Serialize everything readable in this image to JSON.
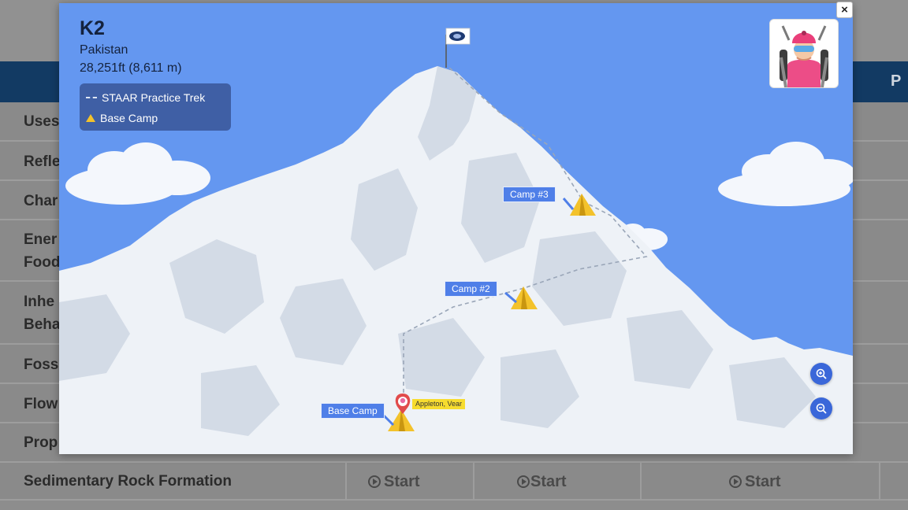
{
  "background": {
    "header_right": "P",
    "rows": [
      {
        "label": "Uses"
      },
      {
        "label": "Refle"
      },
      {
        "label": "Char"
      },
      {
        "label": "Ener Food"
      },
      {
        "label": "Inhe Beha"
      },
      {
        "label": "Foss"
      },
      {
        "label": "Flow"
      },
      {
        "label": "Prop"
      },
      {
        "label": "Sedimentary Rock Formation"
      }
    ],
    "start_label": "Start"
  },
  "modal": {
    "close_label": "×",
    "mountain": {
      "name": "K2",
      "country": "Pakistan",
      "height": "28,251ft (8,611 m)"
    },
    "legend": {
      "trek_label": "STAAR Practice Trek",
      "camp_label": "Base Camp"
    },
    "camps": {
      "base": "Base Camp",
      "camp2": "Camp #2",
      "camp3": "Camp #3"
    },
    "user_tag": "Appleton, Vear",
    "colors": {
      "sky": "#6497f0",
      "tent": "#f3c22b",
      "label_bg": "#4f7fe8",
      "legend_bg": "#3f5fa5"
    },
    "icons": {
      "summit_flag": "flag-icon",
      "zoom_in": "zoom-in-icon",
      "zoom_out": "zoom-out-icon",
      "marker": "location-pin-icon",
      "avatar": "climber-avatar"
    }
  }
}
